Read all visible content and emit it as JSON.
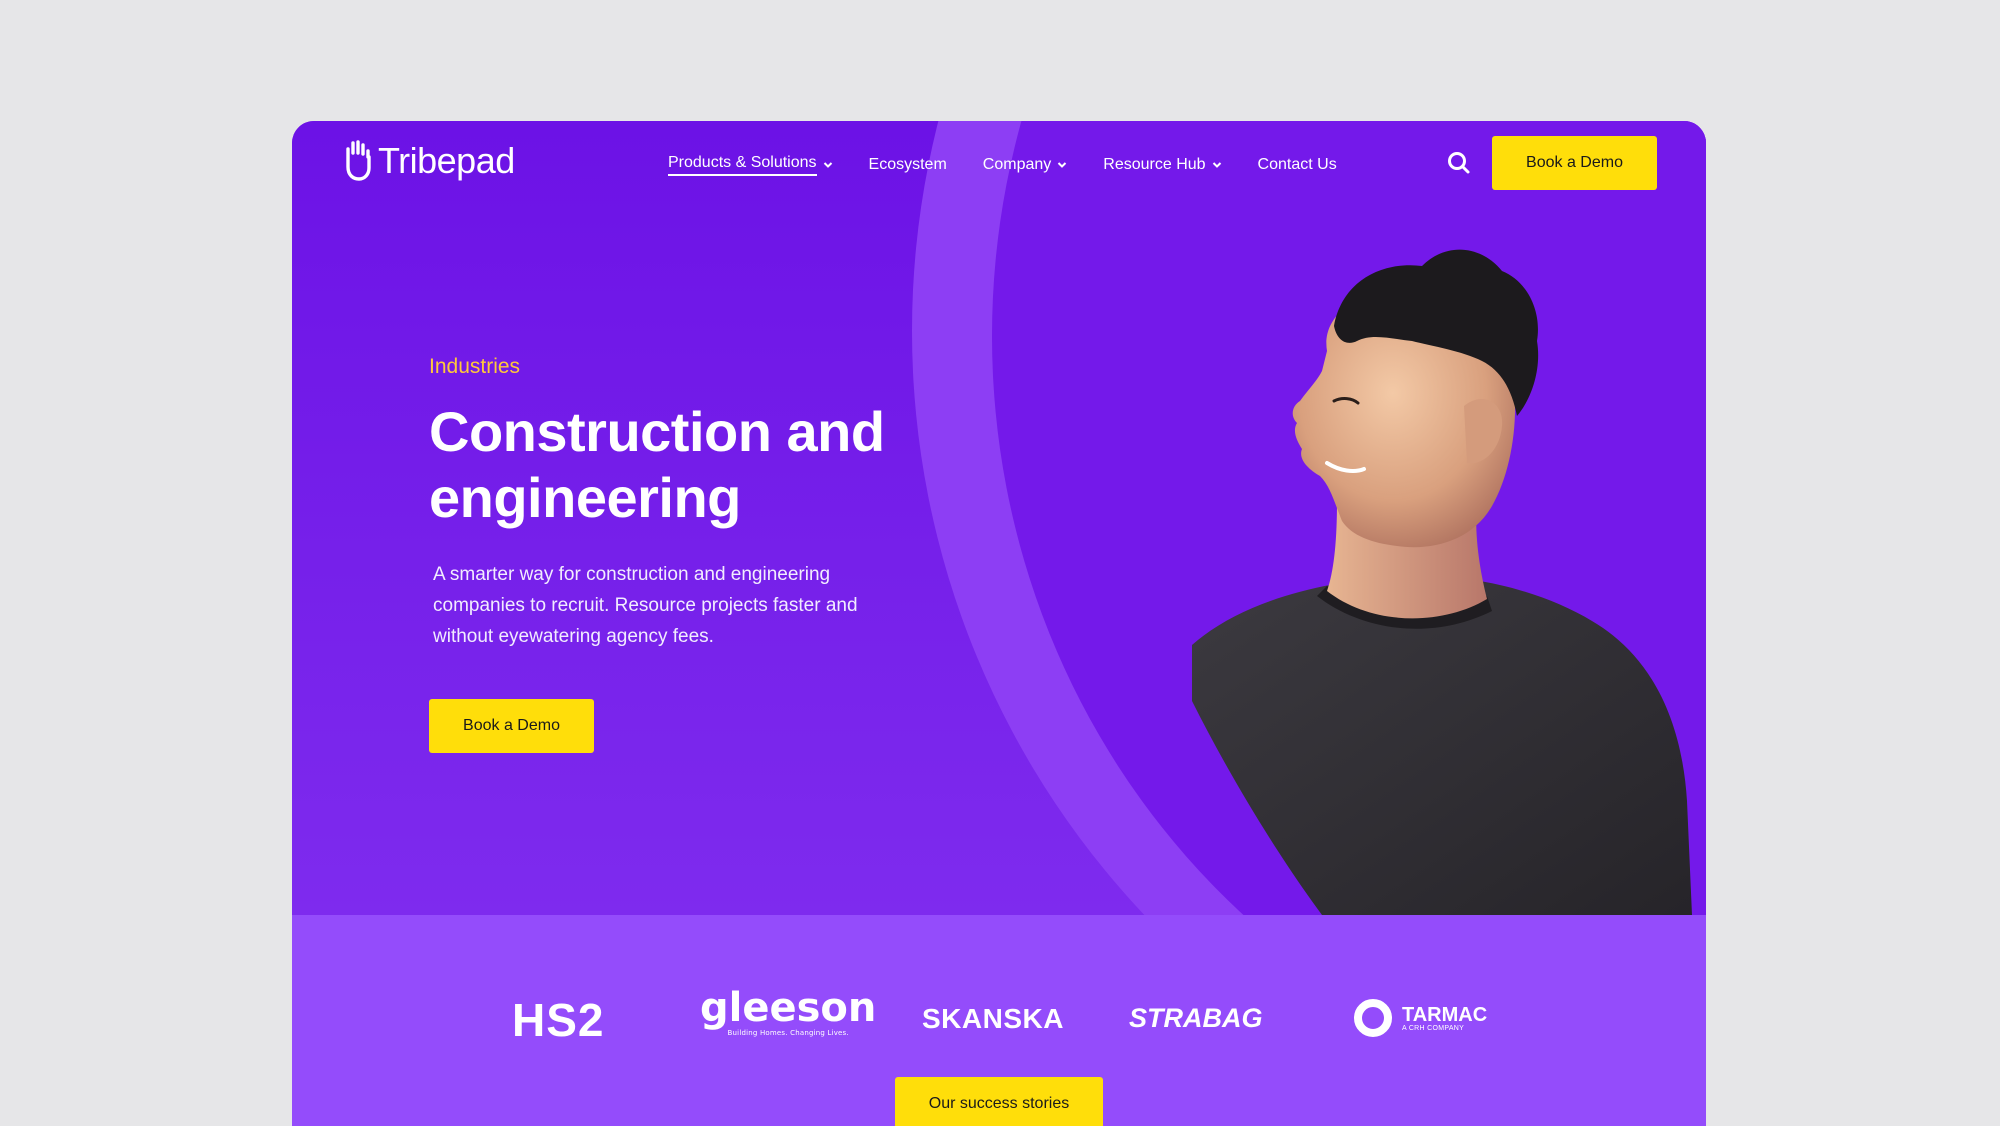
{
  "brand": {
    "name": "Tribepad"
  },
  "nav": {
    "items": [
      {
        "label": "Products & Solutions",
        "dropdown": true,
        "active": true
      },
      {
        "label": "Ecosystem",
        "dropdown": false
      },
      {
        "label": "Company",
        "dropdown": true
      },
      {
        "label": "Resource Hub",
        "dropdown": true
      },
      {
        "label": "Contact Us",
        "dropdown": false
      }
    ],
    "cta_label": "Book a Demo"
  },
  "hero": {
    "eyebrow": "Industries",
    "title": "Construction and engineering",
    "subtitle": "A smarter way for construction and engineering companies to recruit. Resource projects faster and without eyewatering agency fees.",
    "cta_label": "Book a Demo"
  },
  "clients": {
    "hs2": "HS2",
    "gleeson": "gleeson",
    "gleeson_tagline": "Building Homes. Changing Lives.",
    "skanska": "SKANSKA",
    "strabag": "STRABAG",
    "tarmac": "TARMAC",
    "tarmac_sub": "A CRH COMPANY",
    "cta_label": "Our success stories"
  },
  "colors": {
    "accent": "#ffde0a",
    "brand_purple": "#7620ea",
    "eyebrow": "#ffc83a",
    "band": "#944cfb"
  }
}
